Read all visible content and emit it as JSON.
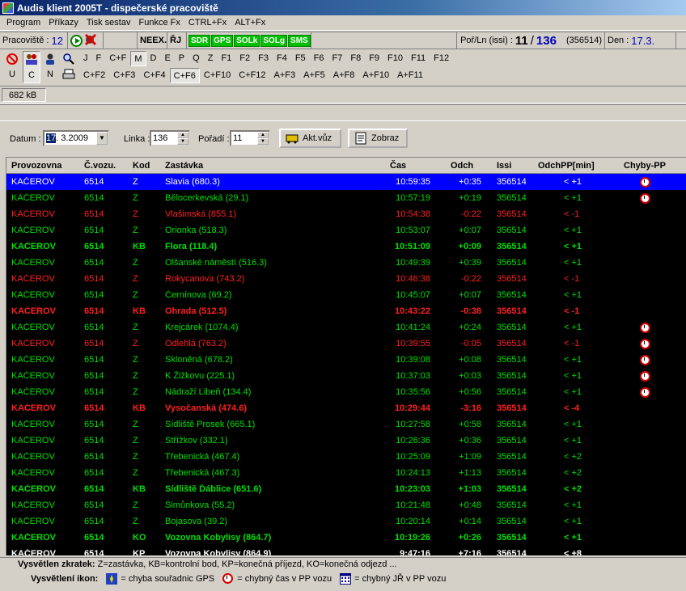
{
  "window": {
    "title": "Audis klient 2005T - dispečerské pracoviště"
  },
  "menu": [
    "Program",
    "Příkazy",
    "Tisk sestav",
    "Funkce Fx",
    "CTRL+Fx",
    "ALT+Fx"
  ],
  "status": {
    "workplace_label": "Pracoviště :",
    "workplace_value": "12",
    "neex": "NEEX.",
    "rj": "ŘJ",
    "green_buttons": [
      "SDR",
      "GPS",
      "SOLk",
      "SOLg",
      "SMS"
    ],
    "por_label": "Poř/Ln (issi) :",
    "por_value": "11",
    "ln_value": "136",
    "issi": "(356514)",
    "day_label": "Den :",
    "day_value": "17.3."
  },
  "toolbar": {
    "icon_labels": [
      "U",
      "C",
      "N"
    ],
    "top_keys": [
      "J",
      "F",
      "C+F",
      "M",
      "D",
      "E",
      "P",
      "Q",
      "Z",
      "F1",
      "F2",
      "F3",
      "F4",
      "F5",
      "F6",
      "F7",
      "F8",
      "F9",
      "F10",
      "F11",
      "F12"
    ],
    "bottom_keys": [
      "C+F2",
      "C+F3",
      "C+F4",
      "C+F6",
      "C+F10",
      "C+F12",
      "A+F3",
      "A+F5",
      "A+F8",
      "A+F10",
      "A+F11"
    ]
  },
  "size_info": "682 kB",
  "filters": {
    "date_label": "Datum :",
    "date_day": "17",
    "date_rest": ". 3.2009",
    "line_label": "Linka :",
    "line_value": "136",
    "order_label": "Pořadí :",
    "order_value": "11",
    "akt_button": "Akt.vůz",
    "show_button": "Zobraz"
  },
  "table": {
    "columns": [
      "Provozovna",
      "Č.vozu.",
      "Kod",
      "Zastávka",
      "Čas",
      "Odch",
      "Issi",
      "OdchPP[min]",
      "Chyby-PP"
    ],
    "colors": {
      "green": "#00e000",
      "red": "#ff2020",
      "white": "#ffffff"
    },
    "rows": [
      {
        "p": "KAČEROV",
        "v": "6514",
        "k": "Z",
        "z": "Slavia (680.3)",
        "t": "10:59:35",
        "o": "+0:35",
        "i": "356514",
        "pp": "< +1",
        "clk": true,
        "col": "white",
        "bold": false,
        "sel": true
      },
      {
        "p": "KAČEROV",
        "v": "6514",
        "k": "Z",
        "z": "Bělocerkevská (29.1)",
        "t": "10:57:19",
        "o": "+0:19",
        "i": "356514",
        "pp": "< +1",
        "clk": true,
        "col": "green",
        "bold": false
      },
      {
        "p": "KAČEROV",
        "v": "6514",
        "k": "Z",
        "z": "Vlašimská (855.1)",
        "t": "10:54:38",
        "o": "-0:22",
        "i": "356514",
        "pp": "< -1",
        "clk": false,
        "col": "red",
        "bold": false
      },
      {
        "p": "KAČEROV",
        "v": "6514",
        "k": "Z",
        "z": "Orionka (518.3)",
        "t": "10:53:07",
        "o": "+0:07",
        "i": "356514",
        "pp": "< +1",
        "clk": false,
        "col": "green",
        "bold": false
      },
      {
        "p": "KAČEROV",
        "v": "6514",
        "k": "KB",
        "z": "Flora (118.4)",
        "t": "10:51:09",
        "o": "+0:09",
        "i": "356514",
        "pp": "< +1",
        "clk": false,
        "col": "green",
        "bold": true
      },
      {
        "p": "KAČEROV",
        "v": "6514",
        "k": "Z",
        "z": "Olšanské náměstí (516.3)",
        "t": "10:49:39",
        "o": "+0:39",
        "i": "356514",
        "pp": "< +1",
        "clk": false,
        "col": "green",
        "bold": false
      },
      {
        "p": "KAČEROV",
        "v": "6514",
        "k": "Z",
        "z": "Rokycanova (743.2)",
        "t": "10:46:38",
        "o": "-0:22",
        "i": "356514",
        "pp": "< -1",
        "clk": false,
        "col": "red",
        "bold": false
      },
      {
        "p": "KAČEROV",
        "v": "6514",
        "k": "Z",
        "z": "Černínova (69.2)",
        "t": "10:45:07",
        "o": "+0:07",
        "i": "356514",
        "pp": "< +1",
        "clk": false,
        "col": "green",
        "bold": false
      },
      {
        "p": "KAČEROV",
        "v": "6514",
        "k": "KB",
        "z": "Ohrada (512.5)",
        "t": "10:43:22",
        "o": "-0:38",
        "i": "356514",
        "pp": "< -1",
        "clk": false,
        "col": "red",
        "bold": true
      },
      {
        "p": "KAČEROV",
        "v": "6514",
        "k": "Z",
        "z": "Krejcárek (1074.4)",
        "t": "10:41:24",
        "o": "+0:24",
        "i": "356514",
        "pp": "< +1",
        "clk": true,
        "col": "green",
        "bold": false
      },
      {
        "p": "KAČEROV",
        "v": "6514",
        "k": "Z",
        "z": "Odlehlá (763.2)",
        "t": "10:39:55",
        "o": "-0:05",
        "i": "356514",
        "pp": "< -1",
        "clk": true,
        "col": "red",
        "bold": false
      },
      {
        "p": "KAČEROV",
        "v": "6514",
        "k": "Z",
        "z": "Skloněná (678.2)",
        "t": "10:39:08",
        "o": "+0:08",
        "i": "356514",
        "pp": "< +1",
        "clk": true,
        "col": "green",
        "bold": false
      },
      {
        "p": "KAČEROV",
        "v": "6514",
        "k": "Z",
        "z": "K Žižkovu (225.1)",
        "t": "10:37:03",
        "o": "+0:03",
        "i": "356514",
        "pp": "< +1",
        "clk": true,
        "col": "green",
        "bold": false
      },
      {
        "p": "KAČEROV",
        "v": "6514",
        "k": "Z",
        "z": "Nádraží Libeň (134.4)",
        "t": "10:35:56",
        "o": "+0:56",
        "i": "356514",
        "pp": "< +1",
        "clk": true,
        "col": "green",
        "bold": false
      },
      {
        "p": "KAČEROV",
        "v": "6514",
        "k": "KB",
        "z": "Vysočanská (474.6)",
        "t": "10:29:44",
        "o": "-3:16",
        "i": "356514",
        "pp": "< -4",
        "clk": false,
        "col": "red",
        "bold": true
      },
      {
        "p": "KAČEROV",
        "v": "6514",
        "k": "Z",
        "z": "Sídliště Prosek (665.1)",
        "t": "10:27:58",
        "o": "+0:58",
        "i": "356514",
        "pp": "< +1",
        "clk": false,
        "col": "green",
        "bold": false
      },
      {
        "p": "KAČEROV",
        "v": "6514",
        "k": "Z",
        "z": "Střížkov (332.1)",
        "t": "10:26:36",
        "o": "+0:36",
        "i": "356514",
        "pp": "< +1",
        "clk": false,
        "col": "green",
        "bold": false
      },
      {
        "p": "KAČEROV",
        "v": "6514",
        "k": "Z",
        "z": "Třebenická (467.4)",
        "t": "10:25:09",
        "o": "+1:09",
        "i": "356514",
        "pp": "< +2",
        "clk": false,
        "col": "green",
        "bold": false
      },
      {
        "p": "KAČEROV",
        "v": "6514",
        "k": "Z",
        "z": "Třebenická (467.3)",
        "t": "10:24:13",
        "o": "+1:13",
        "i": "356514",
        "pp": "< +2",
        "clk": false,
        "col": "green",
        "bold": false
      },
      {
        "p": "KAČEROV",
        "v": "6514",
        "k": "KB",
        "z": "Sídliště Ďáblice (651.6)",
        "t": "10:23:03",
        "o": "+1:03",
        "i": "356514",
        "pp": "< +2",
        "clk": false,
        "col": "green",
        "bold": true
      },
      {
        "p": "KAČEROV",
        "v": "6514",
        "k": "Z",
        "z": "Šimůnkova (55.2)",
        "t": "10:21:48",
        "o": "+0:48",
        "i": "356514",
        "pp": "< +1",
        "clk": false,
        "col": "green",
        "bold": false
      },
      {
        "p": "KAČEROV",
        "v": "6514",
        "k": "Z",
        "z": "Bojasova (39.2)",
        "t": "10:20:14",
        "o": "+0:14",
        "i": "356514",
        "pp": "< +1",
        "clk": false,
        "col": "green",
        "bold": false
      },
      {
        "p": "KAČEROV",
        "v": "6514",
        "k": "KO",
        "z": "Vozovna Kobylisy (864.7)",
        "t": "10:19:26",
        "o": "+0:26",
        "i": "356514",
        "pp": "< +1",
        "clk": false,
        "col": "green",
        "bold": true
      },
      {
        "p": "KAČEROV",
        "v": "6514",
        "k": "KP",
        "z": "Vozovna Kobylisy (864.9)",
        "t": "9:47:16",
        "o": "+7:16",
        "i": "356514",
        "pp": "< +8",
        "clk": false,
        "col": "white",
        "bold": true
      }
    ]
  },
  "legend": {
    "abbr_label": "Vysvětlen zkratek:",
    "abbr_text": " Z=zastávka, KB=kontrolní bod, KP=konečná příjezd, KO=konečná odjezd ...",
    "icons_label": "Vysvětlení ikon:",
    "gps_text": "= chyba souřadnic GPS",
    "time_text": "= chybný čas v PP vozu",
    "jr_text": "= chybný JŘ v PP vozu"
  }
}
